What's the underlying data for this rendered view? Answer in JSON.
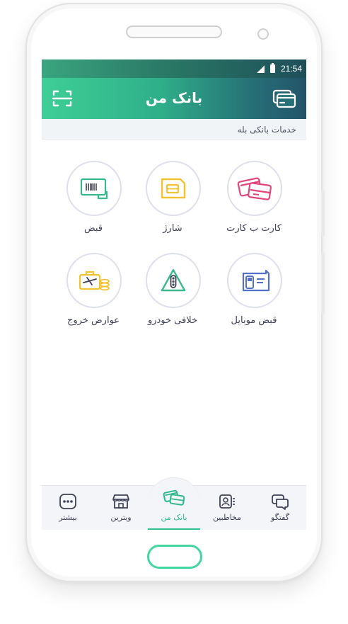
{
  "statusbar": {
    "time": "21:54"
  },
  "appbar": {
    "title": "بانک من",
    "left_icon": "scan-icon",
    "right_icon": "cards-icon"
  },
  "section": {
    "title": "خدمات بانکی بله"
  },
  "services": [
    {
      "label": "کارت ب کارت",
      "icon": "card-to-card-icon",
      "color": "#e0457b"
    },
    {
      "label": "شارژ",
      "icon": "sim-card-icon",
      "color": "#f2c230"
    },
    {
      "label": "قبض",
      "icon": "barcode-bill-icon",
      "color": "#3ab890"
    },
    {
      "label": "قبض موبایل",
      "icon": "mobile-bill-icon",
      "color": "#5470c6"
    },
    {
      "label": "خلافی خودرو",
      "icon": "traffic-light-icon",
      "color": "#3ab890"
    },
    {
      "label": "عوارض خروج",
      "icon": "departure-toll-icon",
      "color": "#f2c230"
    }
  ],
  "tabs": [
    {
      "label": "گفتگو",
      "icon": "chat-icon",
      "active": false
    },
    {
      "label": "مخاطبین",
      "icon": "contacts-icon",
      "active": false
    },
    {
      "label": "بانک من",
      "icon": "bank-cards-icon",
      "active": true
    },
    {
      "label": "ویترین",
      "icon": "store-icon",
      "active": false
    },
    {
      "label": "بیشتر",
      "icon": "more-icon",
      "active": false
    }
  ],
  "colors": {
    "accent": "#2fc08e",
    "appbar_start": "#3ecf96",
    "appbar_end": "#23546a",
    "text": "#3f4156"
  }
}
